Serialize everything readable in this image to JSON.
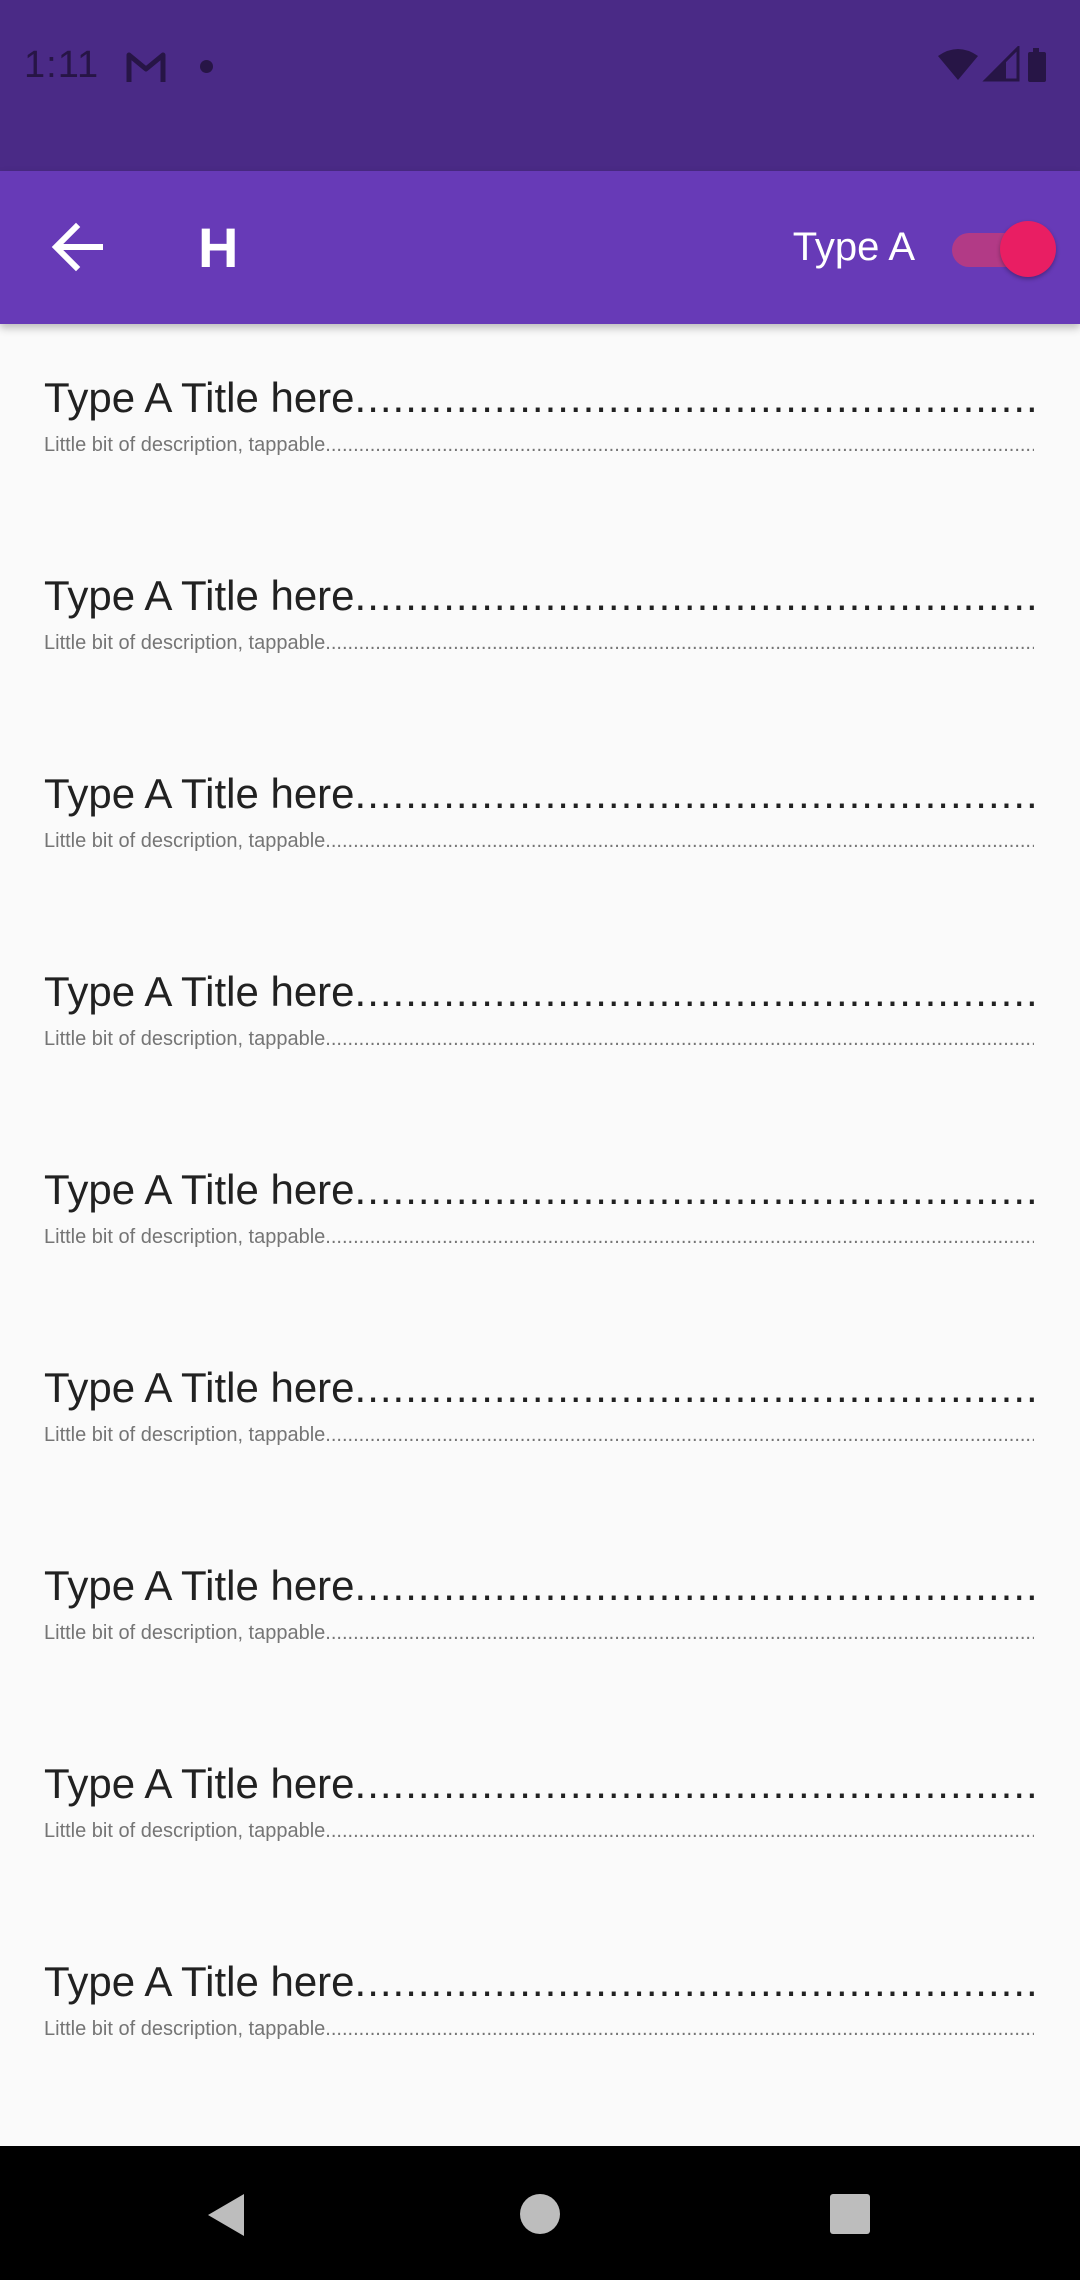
{
  "status_bar": {
    "time": "1:11",
    "notification_icon": "gmail-icon",
    "icons": [
      "wifi-icon",
      "signal-icon",
      "battery-icon"
    ]
  },
  "app_bar": {
    "title": "H",
    "back_icon": "arrow-back-icon",
    "toggle_label": "Type A",
    "toggle_on": true
  },
  "list": {
    "items": [
      {
        "title": "Type A Title here",
        "description": "Little bit of description, tappable"
      },
      {
        "title": "Type A Title here",
        "description": "Little bit of description, tappable"
      },
      {
        "title": "Type A Title here",
        "description": "Little bit of description, tappable"
      },
      {
        "title": "Type A Title here",
        "description": "Little bit of description, tappable"
      },
      {
        "title": "Type A Title here",
        "description": "Little bit of description, tappable"
      },
      {
        "title": "Type A Title here",
        "description": "Little bit of description, tappable"
      },
      {
        "title": "Type A Title here",
        "description": "Little bit of description, tappable"
      },
      {
        "title": "Type A Title here",
        "description": "Little bit of description, tappable"
      },
      {
        "title": "Type A Title here",
        "description": "Little bit of description, tappable"
      }
    ]
  },
  "nav_bar": {
    "icons": [
      "nav-back-icon",
      "nav-home-icon",
      "nav-recents-icon"
    ]
  },
  "colors": {
    "status_bar": "#4a2a86",
    "app_bar": "#673ab7",
    "accent": "#e91e63",
    "background": "#fafafa"
  }
}
